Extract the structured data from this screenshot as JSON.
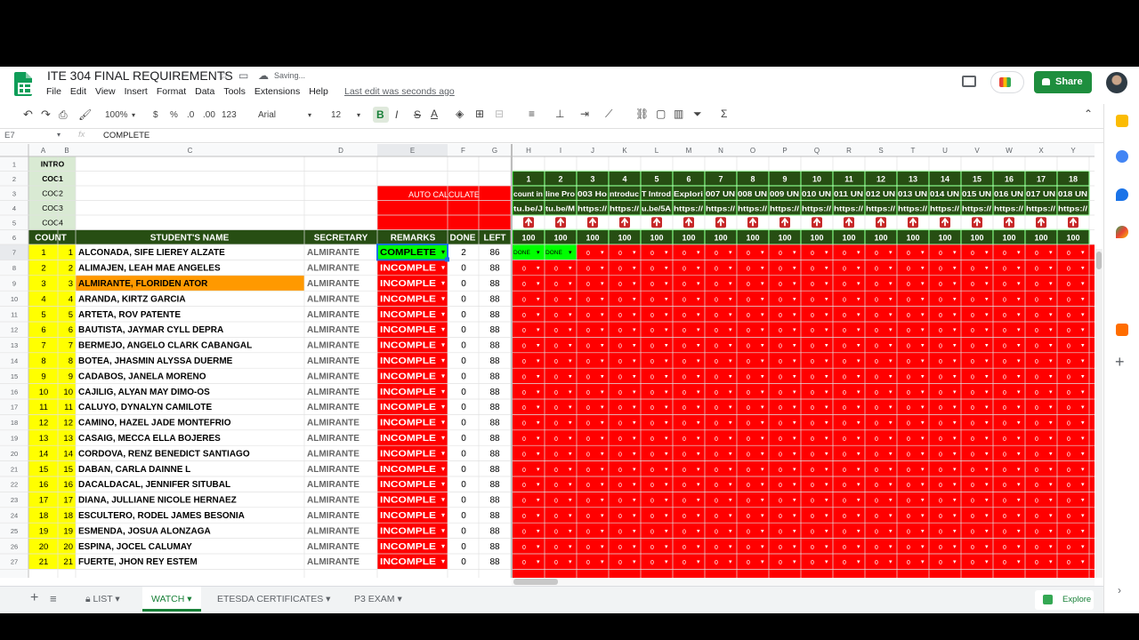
{
  "doc": {
    "title": "ITE 304 FINAL REQUIREMENTS",
    "status": "Saving...",
    "last_edit": "Last edit was seconds ago",
    "share_label": "Share"
  },
  "menu": [
    "File",
    "Edit",
    "View",
    "Insert",
    "Format",
    "Data",
    "Tools",
    "Extensions",
    "Help"
  ],
  "toolbar": {
    "zoom": "100%",
    "currency": "$",
    "percent": "%",
    "dec_less": ".0",
    "dec_more": ".00",
    "num_format": "123",
    "font": "Arial",
    "size": "12",
    "bold": "B",
    "italic": "I",
    "strike": "S",
    "text_color": "A"
  },
  "formula": {
    "cell_ref": "E7",
    "fx": "fx",
    "value": "COMPLETE"
  },
  "grid": {
    "col_letters": [
      "A",
      "B",
      "C",
      "D",
      "E",
      "F",
      "G",
      "H",
      "I",
      "J",
      "K",
      "L",
      "M",
      "N",
      "O",
      "P",
      "Q",
      "R",
      "S",
      "T",
      "U",
      "V",
      "W",
      "X",
      "Y"
    ],
    "row_numbers": [
      "1",
      "2",
      "3",
      "4",
      "5",
      "6",
      "7",
      "8",
      "9",
      "10",
      "11",
      "12",
      "13",
      "14",
      "15",
      "16",
      "17",
      "18",
      "19",
      "20",
      "21",
      "22",
      "23",
      "24",
      "25",
      "26",
      "27"
    ],
    "coc_labels": [
      "INTRO",
      "COC1",
      "COC2",
      "COC3",
      "COC4"
    ],
    "auto_calculate": "AUTO CALCULATE",
    "headers": {
      "count": "COUNT",
      "name": "STUDENT'S NAME",
      "secretary": "SECRETARY",
      "remarks": "REMARKS",
      "done": "DONE",
      "left": "LEFT"
    },
    "task_numbers": [
      "1",
      "2",
      "3",
      "4",
      "5",
      "6",
      "7",
      "8",
      "9",
      "10",
      "11",
      "12",
      "13",
      "14",
      "15",
      "16",
      "17",
      "18"
    ],
    "task_titles": [
      "count in",
      "line Pro",
      "003 Ho",
      "ntroduc",
      "T Introd",
      "Explori",
      "007 UN",
      "008 UN",
      "009 UN",
      "010 UN",
      "011 UN",
      "012 UN",
      "013 UN",
      "014 UN",
      "015 UN",
      "016 UN",
      "017 UN",
      "018 UN"
    ],
    "task_links": [
      "tu.be/J",
      "tu.be/M",
      "https://",
      "https://",
      "u.be/5A",
      "https://",
      "https://",
      "https://",
      "https://",
      "https://",
      "https://",
      "https://",
      "https://",
      "https://",
      "https://",
      "https://",
      "https://",
      "https://"
    ],
    "task_points": [
      "100",
      "100",
      "100",
      "100",
      "100",
      "100",
      "100",
      "100",
      "100",
      "100",
      "100",
      "100",
      "100",
      "100",
      "100",
      "100",
      "100",
      "100"
    ],
    "done_label": "DONE",
    "zero_label": "0",
    "students": [
      {
        "n": "1",
        "c": "1",
        "name": "ALCONADA, SIFE LIEREY ALZATE",
        "sec": "ALMIRANTE",
        "remark": "COMPLETE",
        "done": "2",
        "left": "86"
      },
      {
        "n": "2",
        "c": "2",
        "name": "ALIMAJEN, LEAH MAE ANGELES",
        "sec": "ALMIRANTE",
        "remark": "INCOMPLE",
        "done": "0",
        "left": "88"
      },
      {
        "n": "3",
        "c": "3",
        "name": "ALMIRANTE, FLORIDEN ATOR",
        "sec": "ALMIRANTE",
        "remark": "INCOMPLE",
        "done": "0",
        "left": "88"
      },
      {
        "n": "4",
        "c": "4",
        "name": "ARANDA, KIRTZ GARCIA",
        "sec": "ALMIRANTE",
        "remark": "INCOMPLE",
        "done": "0",
        "left": "88"
      },
      {
        "n": "5",
        "c": "5",
        "name": "ARTETA, ROV PATENTE",
        "sec": "ALMIRANTE",
        "remark": "INCOMPLE",
        "done": "0",
        "left": "88"
      },
      {
        "n": "6",
        "c": "6",
        "name": "BAUTISTA, JAYMAR CYLL DEPRA",
        "sec": "ALMIRANTE",
        "remark": "INCOMPLE",
        "done": "0",
        "left": "88"
      },
      {
        "n": "7",
        "c": "7",
        "name": "BERMEJO, ANGELO CLARK CABANGAL",
        "sec": "ALMIRANTE",
        "remark": "INCOMPLE",
        "done": "0",
        "left": "88"
      },
      {
        "n": "8",
        "c": "8",
        "name": "BOTEA, JHASMIN ALYSSA DUERME",
        "sec": "ALMIRANTE",
        "remark": "INCOMPLE",
        "done": "0",
        "left": "88"
      },
      {
        "n": "9",
        "c": "9",
        "name": "CADABOS, JANELA MORENO",
        "sec": "ALMIRANTE",
        "remark": "INCOMPLE",
        "done": "0",
        "left": "88"
      },
      {
        "n": "10",
        "c": "10",
        "name": "CAJILIG, ALYAN MAY DIMO-OS",
        "sec": "ALMIRANTE",
        "remark": "INCOMPLE",
        "done": "0",
        "left": "88"
      },
      {
        "n": "11",
        "c": "11",
        "name": "CALUYO, DYNALYN CAMILOTE",
        "sec": "ALMIRANTE",
        "remark": "INCOMPLE",
        "done": "0",
        "left": "88"
      },
      {
        "n": "12",
        "c": "12",
        "name": "CAMINO, HAZEL JADE MONTEFRIO",
        "sec": "ALMIRANTE",
        "remark": "INCOMPLE",
        "done": "0",
        "left": "88"
      },
      {
        "n": "13",
        "c": "13",
        "name": "CASAIG, MECCA ELLA BOJERES",
        "sec": "ALMIRANTE",
        "remark": "INCOMPLE",
        "done": "0",
        "left": "88"
      },
      {
        "n": "14",
        "c": "14",
        "name": "CORDOVA, RENZ BENEDICT SANTIAGO",
        "sec": "ALMIRANTE",
        "remark": "INCOMPLE",
        "done": "0",
        "left": "88"
      },
      {
        "n": "15",
        "c": "15",
        "name": "DABAN, CARLA DAINNE L",
        "sec": "ALMIRANTE",
        "remark": "INCOMPLE",
        "done": "0",
        "left": "88"
      },
      {
        "n": "16",
        "c": "16",
        "name": "DACALDACAL, JENNIFER SITUBAL",
        "sec": "ALMIRANTE",
        "remark": "INCOMPLE",
        "done": "0",
        "left": "88"
      },
      {
        "n": "17",
        "c": "17",
        "name": "DIANA, JULLIANE NICOLE HERNAEZ",
        "sec": "ALMIRANTE",
        "remark": "INCOMPLE",
        "done": "0",
        "left": "88"
      },
      {
        "n": "18",
        "c": "18",
        "name": "ESCULTERO, RODEL JAMES BESONIA",
        "sec": "ALMIRANTE",
        "remark": "INCOMPLE",
        "done": "0",
        "left": "88"
      },
      {
        "n": "19",
        "c": "19",
        "name": "ESMENDA, JOSUA ALONZAGA",
        "sec": "ALMIRANTE",
        "remark": "INCOMPLE",
        "done": "0",
        "left": "88"
      },
      {
        "n": "20",
        "c": "20",
        "name": "ESPINA, JOCEL CALUMAY",
        "sec": "ALMIRANTE",
        "remark": "INCOMPLE",
        "done": "0",
        "left": "88"
      },
      {
        "n": "21",
        "c": "21",
        "name": "FUERTE, JHON REY ESTEM",
        "sec": "ALMIRANTE",
        "remark": "INCOMPLE",
        "done": "0",
        "left": "88"
      }
    ]
  },
  "sheets": {
    "list": "LIST",
    "watch": "WATCH",
    "etesda": "ETESDA CERTIFICATES",
    "p3": "P3 EXAM",
    "explore": "Explore"
  },
  "colors": {
    "header_green": "#274e13",
    "complete_green": "#00ff00",
    "incomplete_red": "#ff0000",
    "count_yellow": "#ffff00",
    "coc_green": "#d9ead3",
    "highlight_orange": "#ff9900",
    "task_border": "#00ff00"
  },
  "icons": [
    "undo-icon",
    "redo-icon",
    "print-icon",
    "paint-format-icon",
    "star-icon",
    "move-icon",
    "cloud-icon",
    "comment-icon",
    "meet-icon",
    "explore-icon"
  ]
}
